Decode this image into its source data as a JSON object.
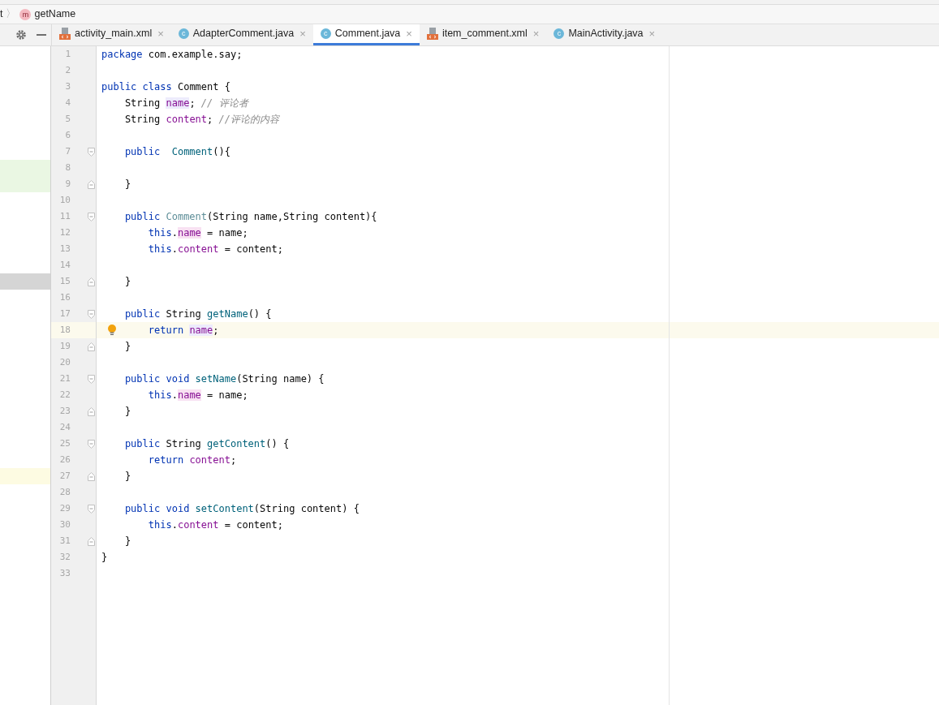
{
  "breadcrumb": [
    {
      "label": "t",
      "kind": "text"
    },
    {
      "label": "getName",
      "kind": "method",
      "icon": "m",
      "separator": "〉"
    }
  ],
  "tabs": [
    {
      "label": "activity_main.xml",
      "kind": "xml",
      "selected": false
    },
    {
      "label": "AdapterComment.java",
      "kind": "class",
      "icon": "c",
      "selected": false
    },
    {
      "label": "Comment.java",
      "kind": "class",
      "icon": "c",
      "selected": true
    },
    {
      "label": "item_comment.xml",
      "kind": "xml",
      "selected": false
    },
    {
      "label": "MainActivity.java",
      "kind": "class",
      "icon": "c",
      "selected": false
    }
  ],
  "close_glyph": "×",
  "lines": [
    {
      "n": "1",
      "tokens": [
        {
          "t": "package",
          "kind": "keyword"
        },
        {
          "t": " com.example.say;",
          "kind": "plain"
        }
      ]
    },
    {
      "n": "2"
    },
    {
      "n": "3",
      "tokens": [
        {
          "t": "public class",
          "kind": "keyword"
        },
        {
          "t": " Comment {",
          "kind": "plain"
        }
      ]
    },
    {
      "n": "4",
      "tokens": [
        {
          "t": "    String ",
          "kind": "plain"
        },
        {
          "t": "name",
          "kind": "readfield"
        },
        {
          "t": "; ",
          "kind": "plain"
        },
        {
          "t": "// 评论者",
          "kind": "comment"
        }
      ]
    },
    {
      "n": "5",
      "tokens": [
        {
          "t": "    String ",
          "kind": "plain"
        },
        {
          "t": "content",
          "kind": "field"
        },
        {
          "t": "; ",
          "kind": "plain"
        },
        {
          "t": "//评论的内容",
          "kind": "comment"
        }
      ]
    },
    {
      "n": "6"
    },
    {
      "n": "7",
      "fold_start": true,
      "tokens": [
        {
          "t": "    public",
          "kind": "keyword"
        },
        {
          "t": "  Comment",
          "kind": "method"
        },
        {
          "t": "(){",
          "kind": "plain"
        }
      ]
    },
    {
      "n": "8",
      "kind": "added"
    },
    {
      "n": "9",
      "fold_end": true,
      "kind": "added",
      "tokens": [
        {
          "t": "    }",
          "kind": "plain"
        }
      ]
    },
    {
      "n": "10"
    },
    {
      "n": "11",
      "fold_start": true,
      "tokens": [
        {
          "t": "    public",
          "kind": "keyword"
        },
        {
          "t": " Comment",
          "kind": "unused"
        },
        {
          "t": "(String name,String content){",
          "kind": "plain"
        }
      ]
    },
    {
      "n": "12",
      "tokens": [
        {
          "t": "        this",
          "kind": "keyword"
        },
        {
          "t": ".",
          "kind": "plain"
        },
        {
          "t": "name",
          "kind": "writefield"
        },
        {
          "t": " = name;",
          "kind": "plain"
        }
      ]
    },
    {
      "n": "13",
      "tokens": [
        {
          "t": "        this",
          "kind": "keyword"
        },
        {
          "t": ".",
          "kind": "plain"
        },
        {
          "t": "content",
          "kind": "field"
        },
        {
          "t": " = content;",
          "kind": "plain"
        }
      ]
    },
    {
      "n": "14"
    },
    {
      "n": "15",
      "fold_end": true,
      "kind": "selected",
      "tokens": [
        {
          "t": "    }",
          "kind": "plain"
        }
      ]
    },
    {
      "n": "16"
    },
    {
      "n": "17",
      "fold_start": true,
      "tokens": [
        {
          "t": "    public",
          "kind": "keyword"
        },
        {
          "t": " String ",
          "kind": "plain"
        },
        {
          "t": "getName",
          "kind": "method"
        },
        {
          "t": "() {",
          "kind": "plain"
        }
      ]
    },
    {
      "n": "18",
      "current": true,
      "bulb": true,
      "tokens": [
        {
          "t": "        return ",
          "kind": "keyword"
        },
        {
          "t": "name",
          "kind": "readfield"
        },
        {
          "t": ";",
          "kind": "plain"
        }
      ]
    },
    {
      "n": "19",
      "fold_end": true,
      "tokens": [
        {
          "t": "    }",
          "kind": "plain"
        }
      ]
    },
    {
      "n": "20"
    },
    {
      "n": "21",
      "fold_start": true,
      "tokens": [
        {
          "t": "    public void",
          "kind": "keyword"
        },
        {
          "t": " setName",
          "kind": "method"
        },
        {
          "t": "(String name) {",
          "kind": "plain"
        }
      ]
    },
    {
      "n": "22",
      "tokens": [
        {
          "t": "        this",
          "kind": "keyword"
        },
        {
          "t": ".",
          "kind": "plain"
        },
        {
          "t": "name",
          "kind": "writefield"
        },
        {
          "t": " = name;",
          "kind": "plain"
        }
      ]
    },
    {
      "n": "23",
      "fold_end": true,
      "tokens": [
        {
          "t": "    }",
          "kind": "plain"
        }
      ]
    },
    {
      "n": "24"
    },
    {
      "n": "25",
      "fold_start": true,
      "tokens": [
        {
          "t": "    public",
          "kind": "keyword"
        },
        {
          "t": " String ",
          "kind": "plain"
        },
        {
          "t": "getContent",
          "kind": "method"
        },
        {
          "t": "() {",
          "kind": "plain"
        }
      ]
    },
    {
      "n": "26",
      "tokens": [
        {
          "t": "        return",
          "kind": "keyword"
        },
        {
          "t": " content",
          "kind": "field"
        },
        {
          "t": ";",
          "kind": "plain"
        }
      ]
    },
    {
      "n": "27",
      "fold_end": true,
      "kind": "changed",
      "tokens": [
        {
          "t": "    }",
          "kind": "plain"
        }
      ]
    },
    {
      "n": "28"
    },
    {
      "n": "29",
      "fold_start": true,
      "tokens": [
        {
          "t": "    public void",
          "kind": "keyword"
        },
        {
          "t": " setContent",
          "kind": "method"
        },
        {
          "t": "(String content) {",
          "kind": "plain"
        }
      ]
    },
    {
      "n": "30",
      "tokens": [
        {
          "t": "        this",
          "kind": "keyword"
        },
        {
          "t": ".",
          "kind": "plain"
        },
        {
          "t": "content",
          "kind": "field"
        },
        {
          "t": " = content;",
          "kind": "plain"
        }
      ]
    },
    {
      "n": "31",
      "fold_end": true,
      "tokens": [
        {
          "t": "    }",
          "kind": "plain"
        }
      ]
    },
    {
      "n": "32",
      "tokens": [
        {
          "t": "}",
          "kind": "plain"
        }
      ]
    },
    {
      "n": "33"
    }
  ]
}
